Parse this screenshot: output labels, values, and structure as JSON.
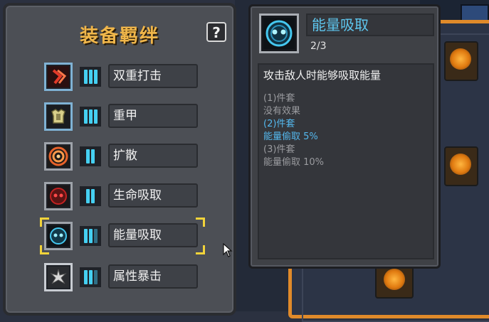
{
  "panel": {
    "title": "装备羁绊",
    "help_label": "?"
  },
  "bonds": [
    {
      "label": "双重打击",
      "icon": "double-strike-icon",
      "bars": 3,
      "lit": 3
    },
    {
      "label": "重甲",
      "icon": "heavy-armor-icon",
      "bars": 3,
      "lit": 3
    },
    {
      "label": "扩散",
      "icon": "spread-icon",
      "bars": 2,
      "lit": 2
    },
    {
      "label": "生命吸取",
      "icon": "life-steal-icon",
      "bars": 2,
      "lit": 2
    },
    {
      "label": "能量吸取",
      "icon": "energy-steal-icon",
      "bars": 3,
      "lit": 2,
      "selected": true
    },
    {
      "label": "属性暴击",
      "icon": "attribute-crit-icon",
      "bars": 3,
      "lit": 2
    }
  ],
  "tooltip": {
    "title": "能量吸取",
    "count": "2/3",
    "description": "攻击敌人时能够吸取能量",
    "tiers": [
      {
        "header": "(1)件套",
        "effect": "没有效果",
        "active": false
      },
      {
        "header": "(2)件套",
        "effect": "能量偷取 5%",
        "active": true
      },
      {
        "header": "(3)件套",
        "effect": "能量偷取 10%",
        "active": false
      }
    ]
  },
  "colors": {
    "title_gold": "#f0b64a",
    "active_blue": "#54b8ee",
    "inactive_gray": "#9a9b9f",
    "bar_cyan": "#45d0f2",
    "selection_yellow": "#f2d33a",
    "accent_orange": "#e08a2a"
  }
}
